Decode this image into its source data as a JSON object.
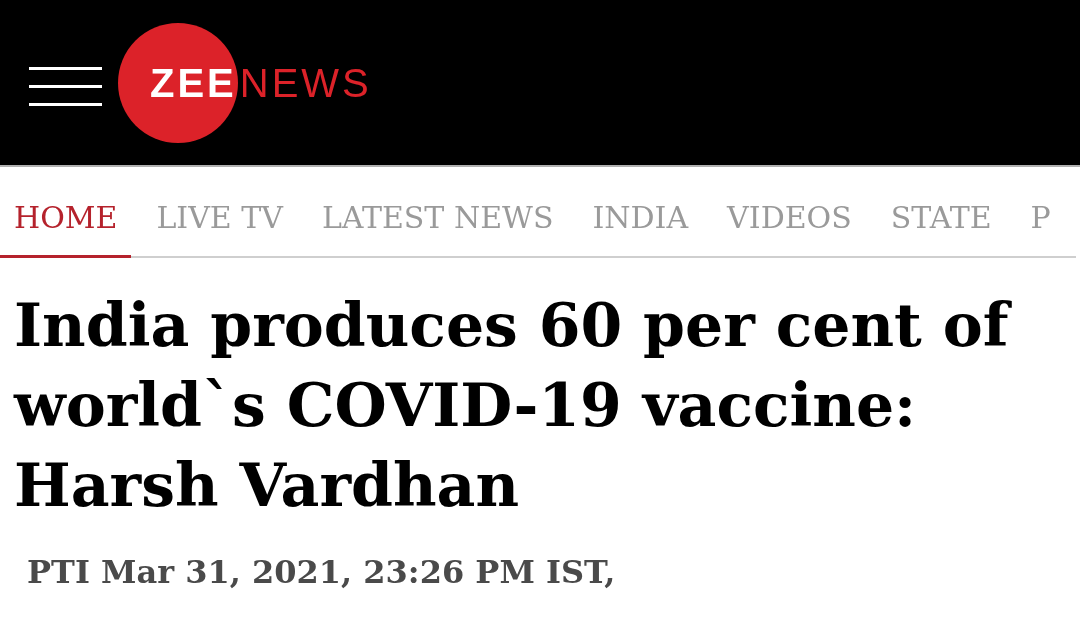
{
  "header": {
    "logo": {
      "prefix": "ZEE",
      "suffix": "NEWS"
    }
  },
  "nav": {
    "tabs": [
      {
        "label": "HOME",
        "selected": true
      },
      {
        "label": "LIVE TV",
        "selected": false
      },
      {
        "label": "LATEST NEWS",
        "selected": false
      },
      {
        "label": "INDIA",
        "selected": false
      },
      {
        "label": "VIDEOS",
        "selected": false
      },
      {
        "label": "STATE",
        "selected": false
      },
      {
        "label": "P",
        "selected": false
      }
    ]
  },
  "article": {
    "headline": "India produces 60 per cent of world`s COVID-19 vaccine: Harsh Vardhan",
    "byline": "PTI Mar 31, 2021, 23:26 PM IST,"
  }
}
